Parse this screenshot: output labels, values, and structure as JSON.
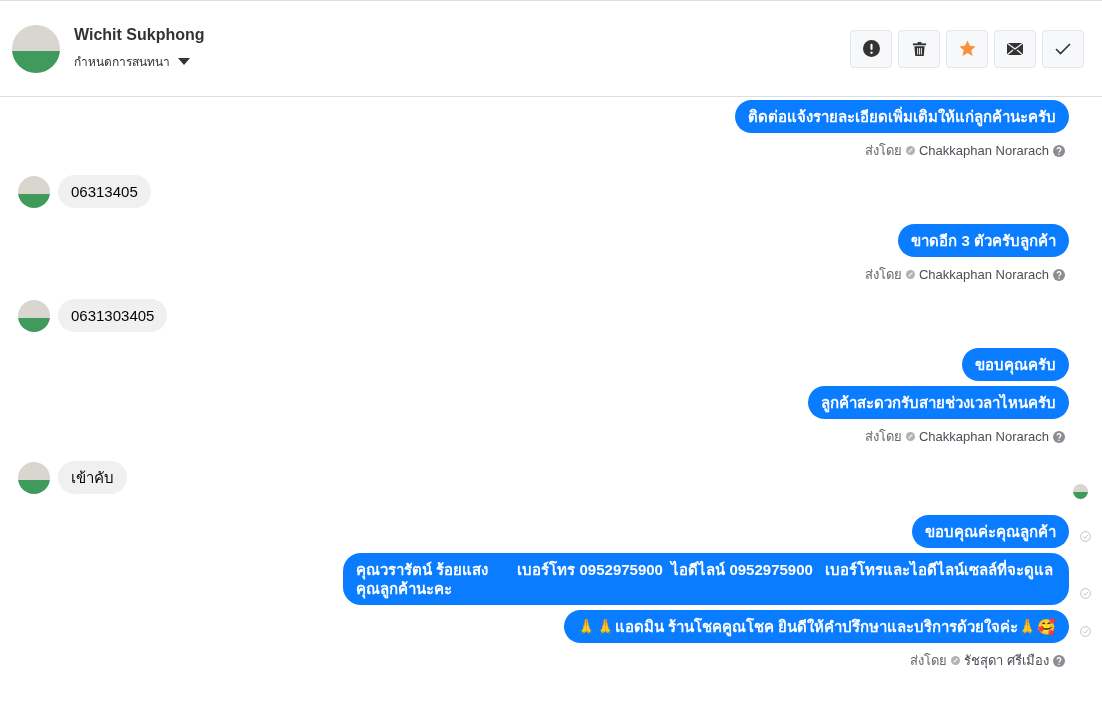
{
  "header": {
    "contact_name": "Wichit Sukphong",
    "subtitle": "กำหนดการสนทนา",
    "actions": [
      {
        "kind": "alert",
        "on": false
      },
      {
        "kind": "delete",
        "on": false
      },
      {
        "kind": "star",
        "on": true
      },
      {
        "kind": "mail",
        "on": false
      },
      {
        "kind": "done",
        "on": false
      }
    ]
  },
  "messages": [
    {
      "kind": "outgoing",
      "text": "ติดต่อแจ้งรายละเอียดเพิ่มเติมให้แก่ลูกค้านะครับ"
    },
    {
      "kind": "sent_by",
      "label": "ส่งโดย",
      "name": "Chakkaphan Norarach"
    },
    {
      "kind": "incoming",
      "text": "06313405"
    },
    {
      "kind": "outgoing",
      "text": "ขาดอีก 3 ตัวครับลูกค้า"
    },
    {
      "kind": "sent_by",
      "label": "ส่งโดย",
      "name": "Chakkaphan Norarach"
    },
    {
      "kind": "incoming",
      "text": "0631303405"
    },
    {
      "kind": "outgoing",
      "text": "ขอบคุณครับ"
    },
    {
      "kind": "outgoing",
      "text": "ลูกค้าสะดวกรับสายช่วงเวลาไหนครับ"
    },
    {
      "kind": "sent_by",
      "label": "ส่งโดย",
      "name": "Chakkaphan Norarach"
    },
    {
      "kind": "incoming",
      "text": "เข้าคับ"
    },
    {
      "kind": "seen"
    },
    {
      "kind": "outgoing",
      "text": "ขอบคุณค่ะคุณลูกค้า",
      "delivered": true
    },
    {
      "kind": "outgoing",
      "text": "คุณวรารัตน์ ร้อยแสง       เบอร์โทร 0952975900  ไอดีไลน์ 0952975900   เบอร์โทรและไอดีไลน์เซลล์ที่จะดูแลคุณลูกค้านะคะ",
      "delivered": true
    },
    {
      "kind": "outgoing",
      "text": "🙏🙏แอดมิน ร้านโชคคูณโชค ยินดีให้คำปรึกษาและบริการด้วยใจค่ะ🙏🥰",
      "delivered": true
    },
    {
      "kind": "sent_by",
      "label": "ส่งโดย",
      "name": "รัชสุดา ศรีเมือง"
    }
  ]
}
